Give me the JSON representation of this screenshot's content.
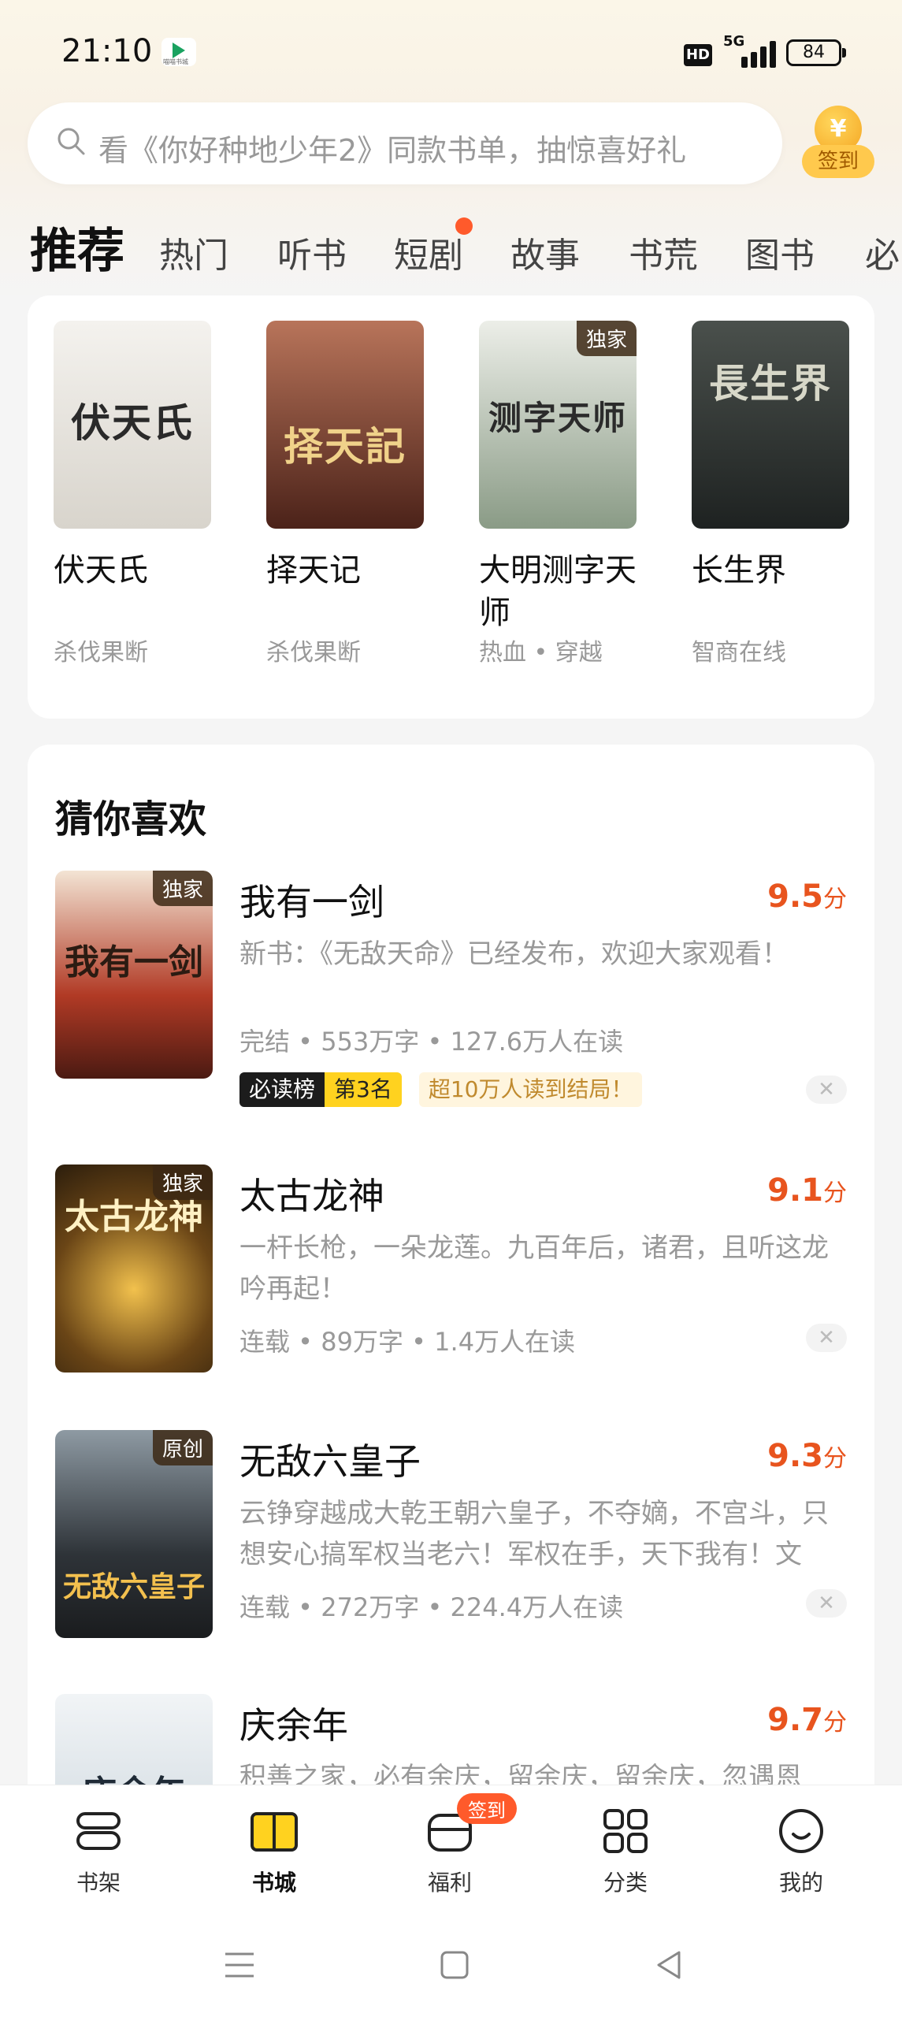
{
  "status_bar": {
    "time": "21:10",
    "app_icon_caption": "喵喵书城",
    "network": "5G",
    "hd": "HD",
    "battery": "84"
  },
  "search": {
    "placeholder": "看《你好种地少年2》同款书单，抽惊喜好礼",
    "signin_coin": "¥",
    "signin_label": "签到"
  },
  "tabs": [
    {
      "label": "推荐",
      "active": true
    },
    {
      "label": "热门"
    },
    {
      "label": "听书"
    },
    {
      "label": "短剧",
      "dot": true
    },
    {
      "label": "故事"
    },
    {
      "label": "书荒"
    },
    {
      "label": "图书"
    },
    {
      "label": "必"
    }
  ],
  "top_books": [
    {
      "title": "伏天氏",
      "tag": "杀伐果断",
      "cover_text": "伏天氏",
      "cover_color": "#e9e6e1",
      "cover_text_color": "#2a2a2a"
    },
    {
      "title": "择天记",
      "tag": "杀伐果断",
      "cover_text": "择天記",
      "cover_color": "#6a3b2e",
      "cover_text_color": "#f0d28a"
    },
    {
      "title": "大明测字天师",
      "tag": "热血 • 穿越",
      "cover_text": "测字天师",
      "cover_color": "#d9dbd2",
      "cover_text_color": "#2b2b2b",
      "badge": "独家"
    },
    {
      "title": "长生界",
      "tag": "智商在线",
      "cover_text": "長生界",
      "cover_color": "#2f3432",
      "cover_text_color": "#d7d7c8"
    }
  ],
  "guess": {
    "section_title": "猜你喜欢",
    "items": [
      {
        "title": "我有一剑",
        "score": "9.5",
        "score_unit": "分",
        "desc": "新书：《无敌天命》已经发布，欢迎大家观看！",
        "meta": "完结 • 553万字 • 127.6万人在读",
        "badge": "独家",
        "cover_text": "我有一剑",
        "cover_color": "#8a2a1c",
        "cover_text_color": "#2b1b12",
        "rank_label": "必读榜",
        "rank_pos": "第3名",
        "read_tag": "超10万人读到结局！"
      },
      {
        "title": "太古龙神",
        "score": "9.1",
        "score_unit": "分",
        "desc": "一杆长枪，一朵龙莲。九百年后，诸君，且听这龙吟再起！",
        "meta": "连载 • 89万字 • 1.4万人在读",
        "badge": "独家",
        "cover_text": "太古龙神",
        "cover_color": "#5c4220",
        "cover_text_color": "#fff1c4"
      },
      {
        "title": "无敌六皇子",
        "score": "9.3",
        "score_unit": "分",
        "desc": "云铮穿越成大乾王朝六皇子，不夺嫡，不宫斗，只想安心搞军权当老六！军权在手，天下我有！文帝...",
        "meta": "连载 • 272万字 • 224.4万人在读",
        "badge": "原创",
        "cover_text": "无敌六皇子",
        "cover_color": "#3a3f44",
        "cover_text_color": "#f3c04e"
      },
      {
        "title": "庆余年",
        "score": "9.7",
        "score_unit": "分",
        "desc": "积善之家，必有余庆，留余庆，留余庆，忽遇恩",
        "cover_text": "庆余年",
        "cover_color": "#dfe5ea",
        "cover_text_color": "#1f2a36"
      }
    ]
  },
  "bottom_nav": [
    {
      "label": "书架",
      "icon": "bookshelf-icon"
    },
    {
      "label": "书城",
      "icon": "book-city-icon",
      "active": true
    },
    {
      "label": "福利",
      "icon": "welfare-icon",
      "badge": "签到"
    },
    {
      "label": "分类",
      "icon": "category-icon"
    },
    {
      "label": "我的",
      "icon": "profile-icon"
    }
  ],
  "colors": {
    "accent": "#ffd21f",
    "score": "#e8541e",
    "badge_orange": "#ff5a2b"
  }
}
